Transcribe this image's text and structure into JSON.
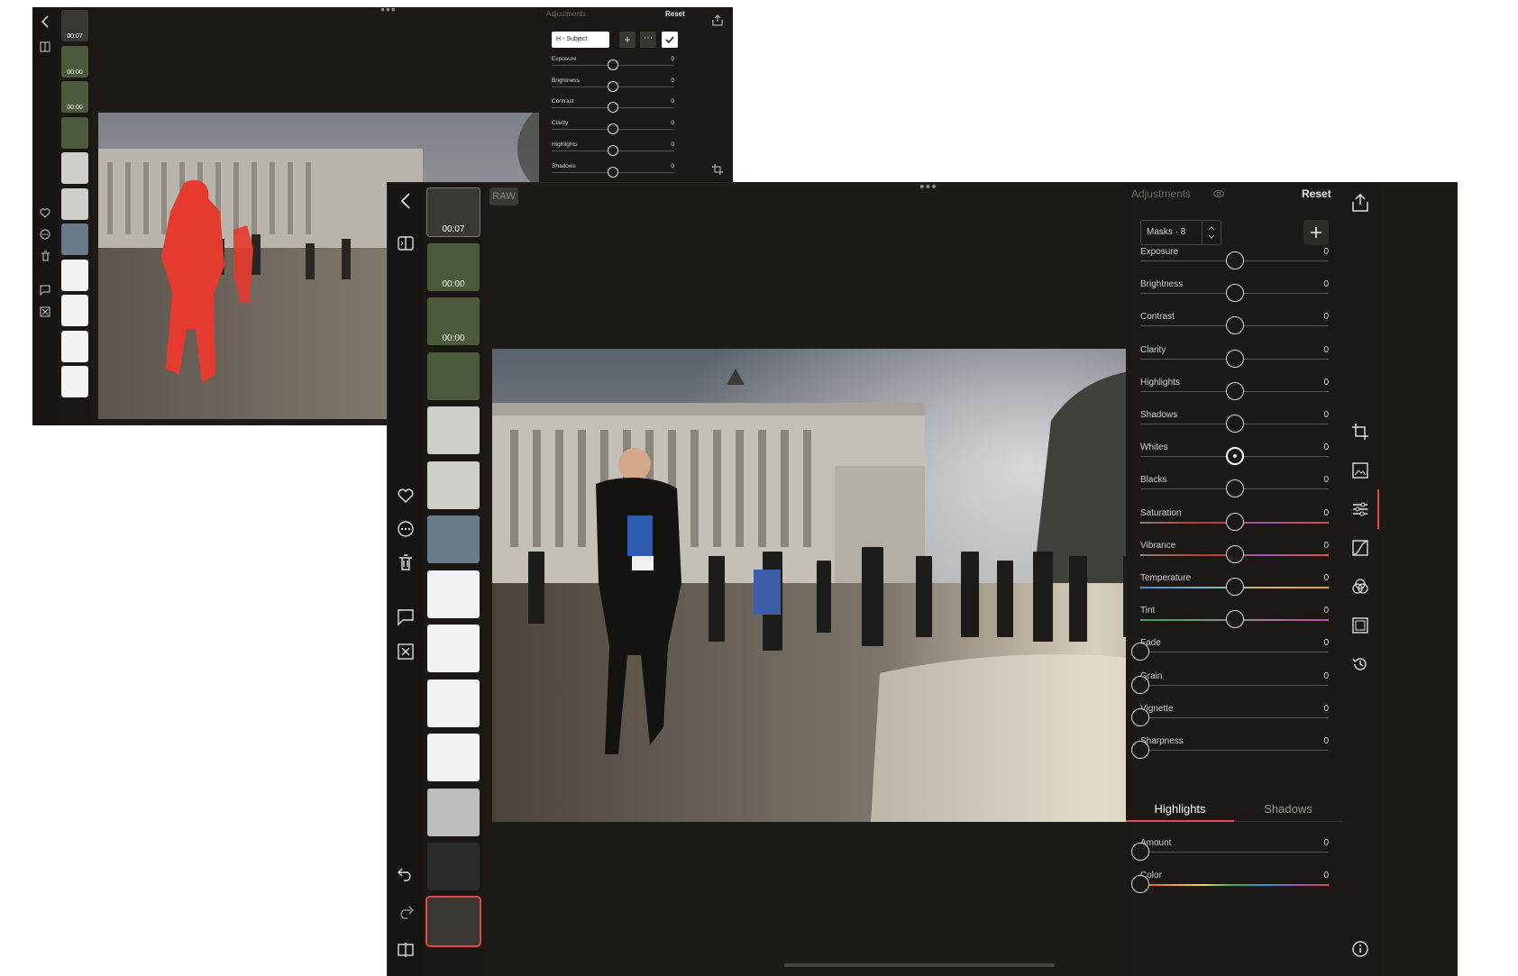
{
  "back": {
    "panel": {
      "title": "Adjustments",
      "reset": "Reset",
      "mask_select": "H - Subject",
      "rows": [
        {
          "label": "Exposure",
          "value": "0"
        },
        {
          "label": "Brightness",
          "value": "0"
        },
        {
          "label": "Contrast",
          "value": "0"
        },
        {
          "label": "Clarity",
          "value": "0"
        },
        {
          "label": "Highlights",
          "value": "0"
        },
        {
          "label": "Shadows",
          "value": "0"
        }
      ]
    },
    "filmstrip": [
      {
        "time": "00:07"
      },
      {
        "time": "00:00"
      },
      {
        "time": "00:00"
      },
      {
        "time": ""
      },
      {
        "time": ""
      },
      {
        "time": ""
      },
      {
        "time": ""
      },
      {
        "time": ""
      },
      {
        "time": ""
      },
      {
        "time": ""
      },
      {
        "time": ""
      }
    ]
  },
  "front": {
    "raw_badge": "RAW",
    "filmstrip": [
      {
        "time": "00:07"
      },
      {
        "time": "00:00"
      },
      {
        "time": "00:00"
      },
      {
        "time": ""
      },
      {
        "time": ""
      },
      {
        "time": ""
      },
      {
        "time": ""
      },
      {
        "time": ""
      },
      {
        "time": ""
      },
      {
        "time": ""
      },
      {
        "time": ""
      },
      {
        "time": ""
      },
      {
        "time": ""
      },
      {
        "time": ""
      }
    ],
    "panel": {
      "title": "Adjustments",
      "reset": "Reset",
      "mask_select": "Masks · 8",
      "rows": [
        {
          "label": "Exposure",
          "value": "0",
          "pos": 0.5,
          "gradient": false
        },
        {
          "label": "Brightness",
          "value": "0",
          "pos": 0.5,
          "gradient": false
        },
        {
          "label": "Contrast",
          "value": "0",
          "pos": 0.5,
          "gradient": false
        },
        {
          "label": "Clarity",
          "value": "0",
          "pos": 0.5,
          "gradient": false
        },
        {
          "label": "Highlights",
          "value": "0",
          "pos": 0.5,
          "gradient": false
        },
        {
          "label": "Shadows",
          "value": "0",
          "pos": 0.5,
          "gradient": false
        },
        {
          "label": "Whites",
          "value": "0",
          "pos": 0.5,
          "gradient": false,
          "active": true
        },
        {
          "label": "Blacks",
          "value": "0",
          "pos": 0.5,
          "gradient": false
        },
        {
          "label": "Saturation",
          "value": "0",
          "pos": 0.5,
          "gradient": "sat"
        },
        {
          "label": "Vibrance",
          "value": "0",
          "pos": 0.5,
          "gradient": "sat"
        },
        {
          "label": "Temperature",
          "value": "0",
          "pos": 0.5,
          "gradient": "temp"
        },
        {
          "label": "Tint",
          "value": "0",
          "pos": 0.5,
          "gradient": "tint"
        },
        {
          "label": "Fade",
          "value": "0",
          "pos": 0,
          "gradient": false
        },
        {
          "label": "Grain",
          "value": "0",
          "pos": 0,
          "gradient": false
        },
        {
          "label": "Vignette",
          "value": "0",
          "pos": 0,
          "gradient": false
        },
        {
          "label": "Sharpness",
          "value": "0",
          "pos": 0,
          "gradient": false
        }
      ],
      "tabs": [
        "Highlights",
        "Shadows"
      ],
      "tone_rows": [
        {
          "label": "Amount",
          "value": "0",
          "pos": 0,
          "gradient": false
        },
        {
          "label": "Color",
          "value": "0",
          "pos": 0,
          "gradient": "hue"
        }
      ]
    },
    "colors": {
      "accent": "#e5484d",
      "background": "#1e1a16"
    }
  }
}
